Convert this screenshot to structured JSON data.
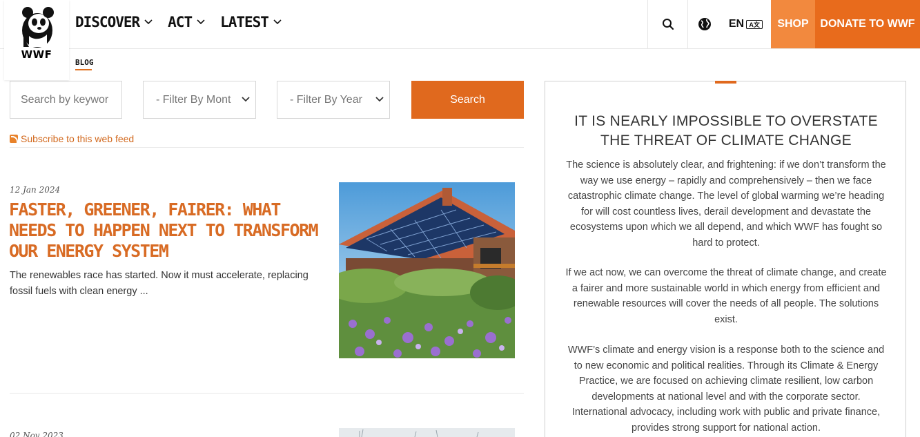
{
  "brand": {
    "logo_text": "WWF"
  },
  "nav": {
    "items": [
      {
        "label": "DISCOVER"
      },
      {
        "label": "ACT"
      },
      {
        "label": "LATEST"
      }
    ]
  },
  "header_right": {
    "lang": "EN",
    "lang_badge": "A文",
    "shop": "SHOP",
    "donate": "DONATE TO WWF"
  },
  "subnav": {
    "active": "BLOG"
  },
  "filters": {
    "search_placeholder": "Search by keywor",
    "month": "- Filter By Mont",
    "year": "- Filter By Year",
    "search_button": "Search"
  },
  "subscribe": "Subscribe to this web feed",
  "articles": [
    {
      "date": "12 Jan 2024",
      "title": "Faster, greener, fairer: what needs to happen next to transform our energy system",
      "excerpt": "The renewables race has started. Now it must accelerate, replacing fossil fuels with clean energy ..."
    },
    {
      "date": "02 Nov 2023"
    }
  ],
  "sidebar": {
    "title": "IT IS NEARLY IMPOSSIBLE TO OVERSTATE THE THREAT OF CLIMATE CHANGE",
    "paragraphs": [
      "The science is absolutely clear, and frightening: if we don’t transform the way we use energy – rapidly and comprehensively – then we face catastrophic climate change. The level of global warming we’re heading for will cost countless lives, derail development and devastate the ecosystems upon which we all depend, and which WWF has fought so hard to protect.",
      "If we act now, we can overcome the threat of climate change, and create a fairer and more sustainable world in which energy from efficient and renewable resources will cover the needs of all people. The solutions exist.",
      "WWF’s climate and energy vision is a response both to the science and to new economic and political realities. Through its Climate & Energy Practice, we are focused on achieving climate resilient, low carbon developments at national level and with the corporate sector. International advocacy, including work with public and private finance, provides strong support for national action."
    ]
  }
}
